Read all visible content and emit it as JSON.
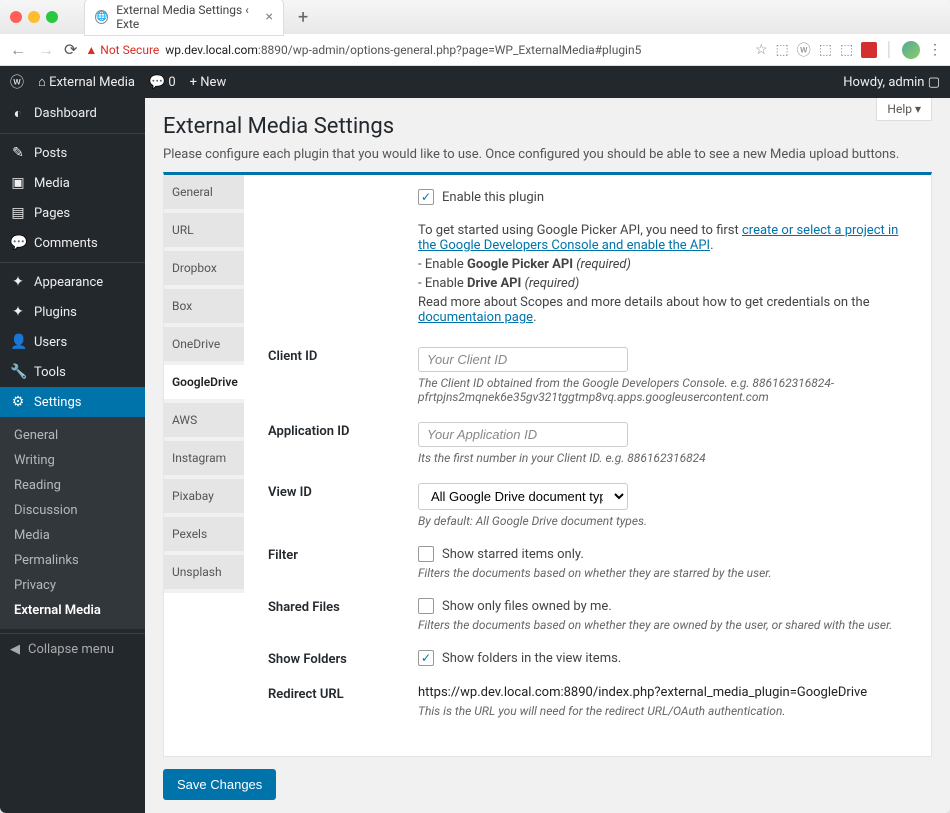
{
  "browser": {
    "tab_title": "External Media Settings ‹ Exte",
    "not_secure": "Not Secure",
    "url_host": "wp.dev.local.com",
    "url_rest": ":8890/wp-admin/options-general.php?page=WP_ExternalMedia#plugin5"
  },
  "wp_bar": {
    "site_name": "External Media",
    "comments": "0",
    "new": "New",
    "howdy": "Howdy, admin"
  },
  "sidebar": {
    "items": [
      {
        "icon": "◐",
        "label": "Dashboard"
      },
      {
        "icon": "✎",
        "label": "Posts"
      },
      {
        "icon": "▣",
        "label": "Media"
      },
      {
        "icon": "▤",
        "label": "Pages"
      },
      {
        "icon": "💬",
        "label": "Comments"
      },
      {
        "icon": "✦",
        "label": "Appearance"
      },
      {
        "icon": "✦",
        "label": "Plugins"
      },
      {
        "icon": "👤",
        "label": "Users"
      },
      {
        "icon": "🔧",
        "label": "Tools"
      },
      {
        "icon": "⚙",
        "label": "Settings"
      }
    ],
    "sub": [
      "General",
      "Writing",
      "Reading",
      "Discussion",
      "Media",
      "Permalinks",
      "Privacy",
      "External Media"
    ],
    "collapse": "Collapse menu"
  },
  "content": {
    "help": "Help ▾",
    "title": "External Media Settings",
    "desc": "Please configure each plugin that you would like to use. Once configured you should be able to see a new Media upload buttons.",
    "tabs": [
      "General",
      "URL",
      "Dropbox",
      "Box",
      "OneDrive",
      "GoogleDrive",
      "AWS",
      "Instagram",
      "Pixabay",
      "Pexels",
      "Unsplash"
    ],
    "active_tab": "GoogleDrive",
    "enable_label": "Enable this plugin",
    "intro_line": "To get started using Google Picker API, you need to first ",
    "intro_link": "create or select a project in the Google Developers Console and enable the API",
    "enable1_pre": "- Enable ",
    "enable1_b": "Google Picker API",
    "enable2_pre": "- Enable ",
    "enable2_b": "Drive API",
    "required": " (required)",
    "read_more": "Read more about Scopes and more details about how to get credentials on the ",
    "doc_link": "documentaion page",
    "fields": {
      "client_id": {
        "label": "Client ID",
        "placeholder": "Your Client ID",
        "hint": "The Client ID obtained from the Google Developers Console. e.g. 886162316824-pfrtpjns2mqnek6e35gv321tggtmp8vq.apps.googleusercontent.com"
      },
      "app_id": {
        "label": "Application ID",
        "placeholder": "Your Application ID",
        "hint": "Its the first number in your Client ID. e.g. 886162316824"
      },
      "view_id": {
        "label": "View ID",
        "value": "All Google Drive document types.",
        "hint": "By default: All Google Drive document types."
      },
      "filter": {
        "label": "Filter",
        "check": "Show starred items only.",
        "hint": "Filters the documents based on whether they are starred by the user."
      },
      "shared": {
        "label": "Shared Files",
        "check": "Show only files owned by me.",
        "hint": "Filters the documents based on whether they are owned by the user, or shared with the user."
      },
      "folders": {
        "label": "Show Folders",
        "check": "Show folders in the view items."
      },
      "redirect": {
        "label": "Redirect URL",
        "value": "https://wp.dev.local.com:8890/index.php?external_media_plugin=GoogleDrive",
        "hint": "This is the URL you will need for the redirect URL/OAuth authentication."
      }
    },
    "save": "Save Changes"
  }
}
